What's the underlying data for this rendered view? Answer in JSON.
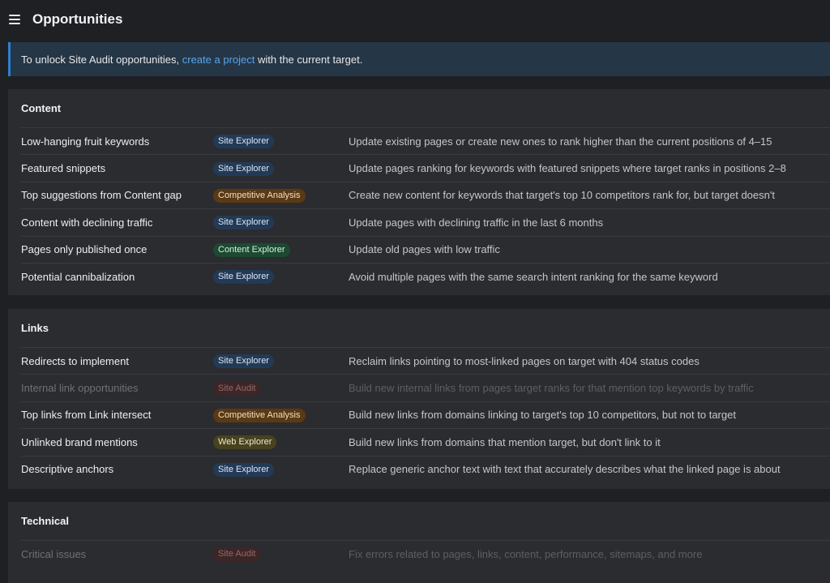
{
  "header": {
    "title": "Opportunities",
    "menu_icon": "hamburger-menu-icon"
  },
  "banner": {
    "prefix": "To unlock Site Audit opportunities, ",
    "link": "create a project",
    "suffix": " with the current target."
  },
  "colors": {
    "tag_blue": "#233a57",
    "tag_orange": "#5a3a14",
    "tag_green": "#1c4a30",
    "tag_olive": "#48421e",
    "tag_red_disabled": "#3e2526",
    "link": "#58a6ee"
  },
  "sections": [
    {
      "title": "Content",
      "rows": [
        {
          "name": "Low-hanging fruit keywords",
          "tag": "Site Explorer",
          "tag_color": "blue",
          "desc": "Update existing pages or create new ones to rank higher than the current positions of 4–15",
          "disabled": false
        },
        {
          "name": "Featured snippets",
          "tag": "Site Explorer",
          "tag_color": "blue",
          "desc": "Update pages ranking for keywords with featured snippets where target ranks in positions 2–8",
          "disabled": false
        },
        {
          "name": "Top suggestions from Content gap",
          "tag": "Competitive Analysis",
          "tag_color": "orange",
          "desc": "Create new content for keywords that target's top 10 competitors rank for, but target doesn't",
          "disabled": false
        },
        {
          "name": "Content with declining traffic",
          "tag": "Site Explorer",
          "tag_color": "blue",
          "desc": "Update pages with declining traffic in the last 6 months",
          "disabled": false
        },
        {
          "name": "Pages only published once",
          "tag": "Content Explorer",
          "tag_color": "green",
          "desc": "Update old pages with low traffic",
          "disabled": false
        },
        {
          "name": "Potential cannibalization",
          "tag": "Site Explorer",
          "tag_color": "blue",
          "desc": "Avoid multiple pages with the same search intent ranking for the same keyword",
          "disabled": false
        }
      ]
    },
    {
      "title": "Links",
      "rows": [
        {
          "name": "Redirects to implement",
          "tag": "Site Explorer",
          "tag_color": "blue",
          "desc": "Reclaim links pointing to most-linked pages on target with 404 status codes",
          "disabled": false
        },
        {
          "name": "Internal link opportunities",
          "tag": "Site Audit",
          "tag_color": "red",
          "desc": "Build new internal links from pages target ranks for that mention top keywords by traffic",
          "disabled": true
        },
        {
          "name": "Top links from Link intersect",
          "tag": "Competitive Analysis",
          "tag_color": "orange",
          "desc": "Build new links from domains linking to target's top 10 competitors, but not to target",
          "disabled": false
        },
        {
          "name": "Unlinked brand mentions",
          "tag": "Web Explorer",
          "tag_color": "olive",
          "desc": "Build new links from domains that mention target, but don't link to it",
          "disabled": false
        },
        {
          "name": "Descriptive anchors",
          "tag": "Site Explorer",
          "tag_color": "blue",
          "desc": "Replace generic anchor text with text that accurately describes what the linked page is about",
          "disabled": false
        }
      ]
    },
    {
      "title": "Technical",
      "rows": [
        {
          "name": "Critical issues",
          "tag": "Site Audit",
          "tag_color": "red",
          "desc": "Fix errors related to pages, links, content, performance, sitemaps, and more",
          "disabled": true
        }
      ]
    }
  ]
}
